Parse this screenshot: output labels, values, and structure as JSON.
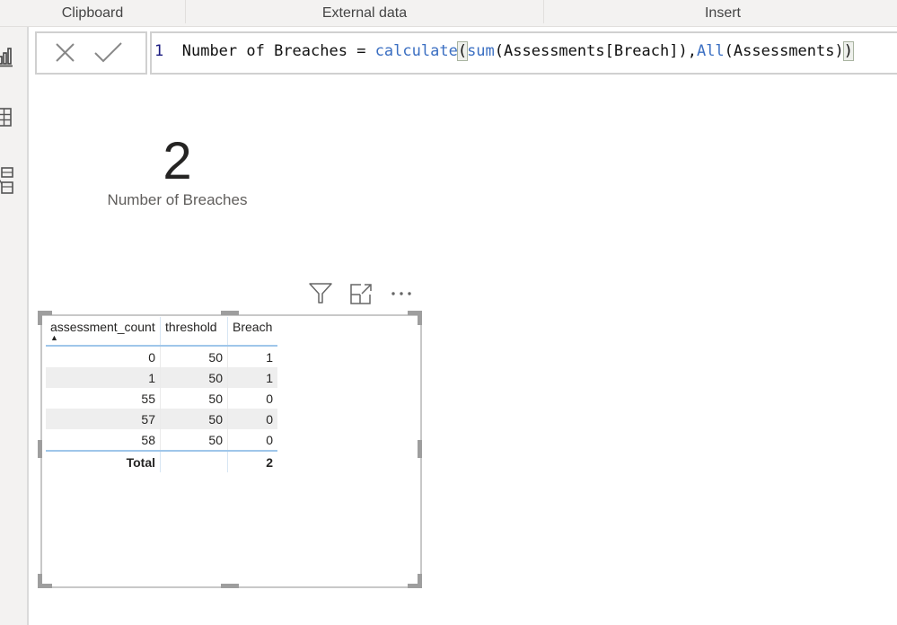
{
  "ribbon": {
    "groups": [
      "Clipboard",
      "External data",
      "Insert"
    ]
  },
  "left_nav": {
    "icons": [
      "report-view-icon",
      "data-view-icon",
      "model-view-icon"
    ]
  },
  "formula_bar": {
    "cancel_icon": "close-icon",
    "commit_icon": "check-icon",
    "line_number": "1",
    "measure_name": "Number of Breaches",
    "equals": " = ",
    "func_calculate": "calculate",
    "open_paren": "(",
    "func_sum": "sum",
    "sum_args": "(Assessments[Breach]),",
    "func_all": "All",
    "all_args": "(Assessments)",
    "close_paren": ")"
  },
  "card": {
    "value": "2",
    "label": "Number of Breaches"
  },
  "visual_header": {
    "filter_icon": "filter-icon",
    "focus_icon": "focus-mode-icon",
    "more_icon": "more-options-icon"
  },
  "table": {
    "columns": [
      "assessment_count",
      "threshold",
      "Breach"
    ],
    "sort_column": "assessment_count",
    "sort_direction": "ascending",
    "rows": [
      [
        "0",
        "50",
        "1"
      ],
      [
        "1",
        "50",
        "1"
      ],
      [
        "55",
        "50",
        "0"
      ],
      [
        "57",
        "50",
        "0"
      ],
      [
        "58",
        "50",
        "0"
      ]
    ],
    "total": {
      "label": "Total",
      "threshold": "",
      "breach": "2"
    }
  }
}
